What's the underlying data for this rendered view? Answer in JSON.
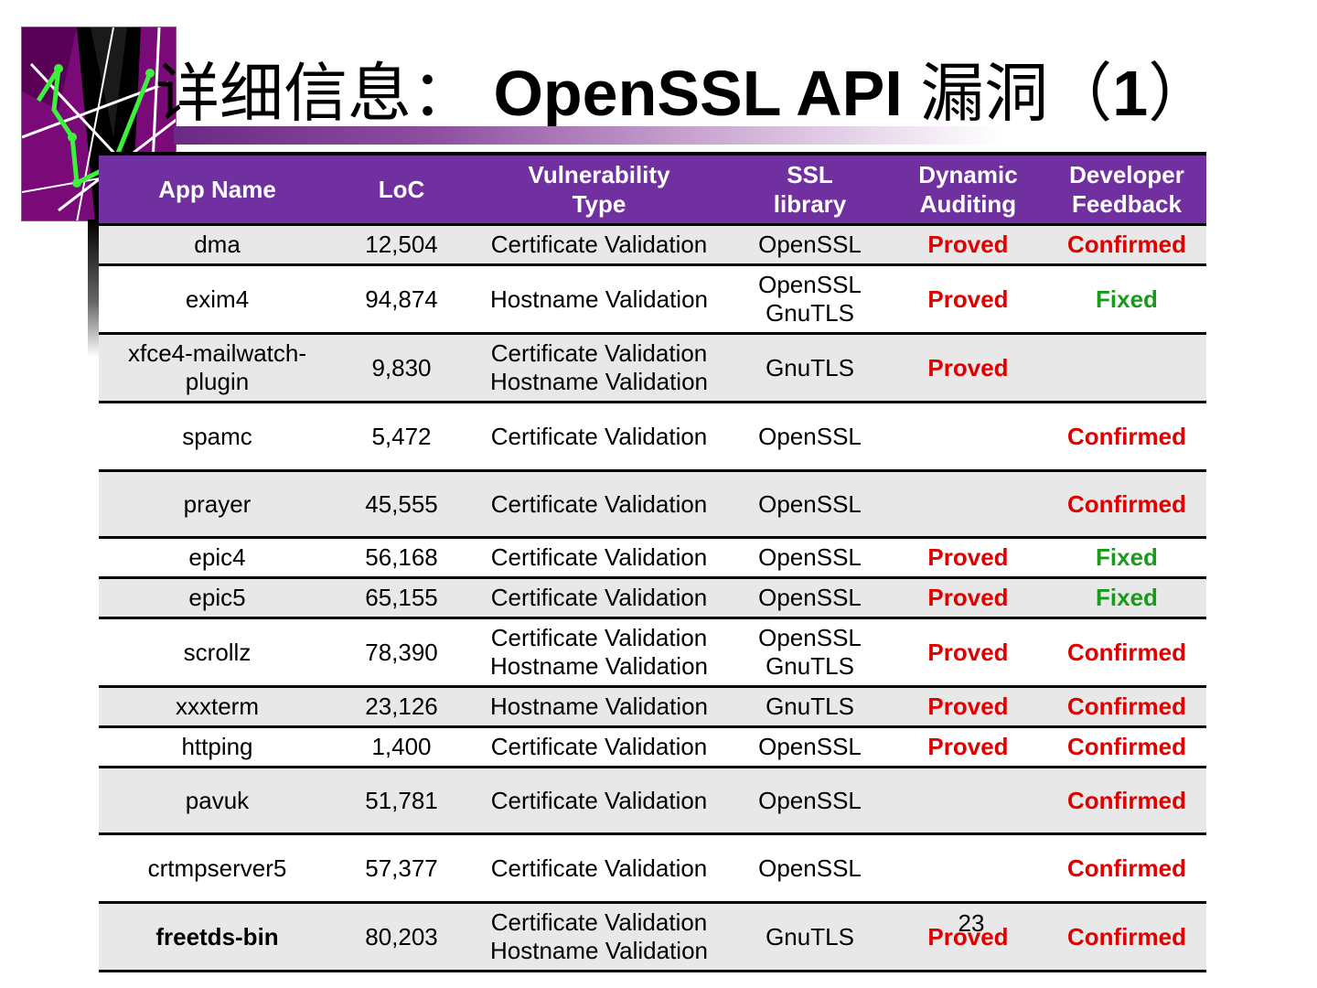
{
  "title": {
    "prefix": "详细信息：",
    "main": "OpenSSL API",
    "suffix_cn": "漏洞（",
    "number": "1",
    "close": "）"
  },
  "table": {
    "headers": [
      "App Name",
      "LoC",
      "Vulnerability\nType",
      "SSL\nlibrary",
      "Dynamic\nAuditing",
      "Developer\nFeedback"
    ],
    "rows": [
      {
        "app": "dma",
        "loc": "12,504",
        "vuln": "Certificate Validation",
        "lib": "OpenSSL",
        "audit": "Proved",
        "feedback": "Confirmed"
      },
      {
        "app": "exim4",
        "loc": "94,874",
        "vuln": "Hostname Validation",
        "lib": "OpenSSL\nGnuTLS",
        "audit": "Proved",
        "feedback": "Fixed"
      },
      {
        "app": "xfce4-mailwatch-\nplugin",
        "loc": "9,830",
        "vuln": "Certificate Validation\nHostname Validation",
        "lib": "GnuTLS",
        "audit": "Proved",
        "feedback": ""
      },
      {
        "app": "spamc",
        "loc": "5,472",
        "vuln": "Certificate Validation",
        "lib": "OpenSSL",
        "audit": "",
        "feedback": "Confirmed"
      },
      {
        "app": "prayer",
        "loc": "45,555",
        "vuln": "Certificate Validation",
        "lib": "OpenSSL",
        "audit": "",
        "feedback": "Confirmed"
      },
      {
        "app": "epic4",
        "loc": "56,168",
        "vuln": "Certificate Validation",
        "lib": "OpenSSL",
        "audit": "Proved",
        "feedback": "Fixed"
      },
      {
        "app": "epic5",
        "loc": "65,155",
        "vuln": "Certificate Validation",
        "lib": "OpenSSL",
        "audit": "Proved",
        "feedback": "Fixed"
      },
      {
        "app": "scrollz",
        "loc": "78,390",
        "vuln": "Certificate Validation\nHostname Validation",
        "lib": "OpenSSL\nGnuTLS",
        "audit": "Proved",
        "feedback": "Confirmed"
      },
      {
        "app": "xxxterm",
        "loc": "23,126",
        "vuln": "Hostname Validation",
        "lib": "GnuTLS",
        "audit": "Proved",
        "feedback": "Confirmed"
      },
      {
        "app": "httping",
        "loc": "1,400",
        "vuln": "Certificate Validation",
        "lib": "OpenSSL",
        "audit": "Proved",
        "feedback": "Confirmed"
      },
      {
        "app": "pavuk",
        "loc": "51,781",
        "vuln": "Certificate Validation",
        "lib": "OpenSSL",
        "audit": "",
        "feedback": "Confirmed"
      },
      {
        "app": "crtmpserver5",
        "loc": "57,377",
        "vuln": "Certificate Validation",
        "lib": "OpenSSL",
        "audit": "",
        "feedback": "Confirmed"
      },
      {
        "app": "freetds-bin",
        "loc": "80,203",
        "vuln": "Certificate Validation\nHostname Validation",
        "lib": "GnuTLS",
        "audit": "Proved",
        "feedback": "Confirmed"
      }
    ]
  },
  "page_number": "23",
  "colors": {
    "header_bg": "#7030a0",
    "proved": "#e00000",
    "confirmed": "#e00000",
    "fixed": "#1a9a1a",
    "row_alt": "#e8e8e8"
  },
  "logo": {
    "icon": "purple-network-logo-icon"
  }
}
